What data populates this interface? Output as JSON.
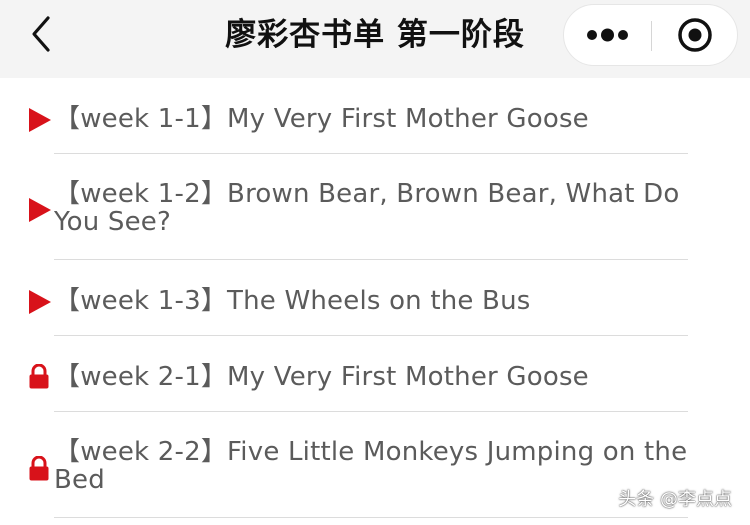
{
  "header": {
    "title": "廖彩杏书单 第一阶段",
    "back_icon": "chevron-left-icon",
    "more_icon": "more-dots-icon",
    "close_icon": "target-close-icon"
  },
  "colors": {
    "accent": "#d8121a",
    "text": "#5b5b5b",
    "header_bg": "#f4f4f4",
    "separator": "#dcdcdc"
  },
  "lessons": [
    {
      "label": "【week 1-1】My Very First Mother Goose",
      "status": "play",
      "icon": "play-icon"
    },
    {
      "label": "【week 1-2】Brown Bear, Brown Bear, What Do You See?",
      "status": "play",
      "icon": "play-icon"
    },
    {
      "label": "【week 1-3】The Wheels on the Bus",
      "status": "play",
      "icon": "play-icon"
    },
    {
      "label": "【week 2-1】My Very First Mother Goose",
      "status": "locked",
      "icon": "lock-icon"
    },
    {
      "label": "【week 2-2】Five Little Monkeys Jumping on the Bed",
      "status": "locked",
      "icon": "lock-icon"
    }
  ],
  "watermark": "头条 @李点点"
}
